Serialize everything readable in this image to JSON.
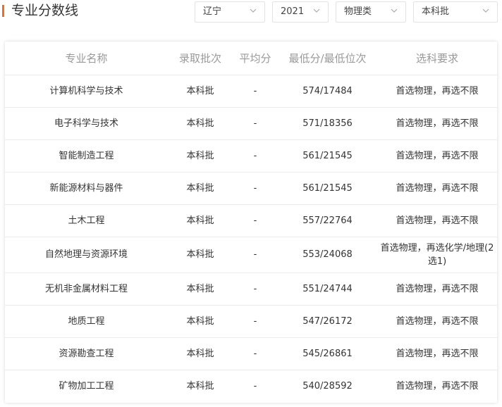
{
  "header": {
    "title": "专业分数线",
    "filters": [
      {
        "value": "辽宁"
      },
      {
        "value": "2021"
      },
      {
        "value": "物理类"
      },
      {
        "value": "本科批"
      }
    ]
  },
  "table": {
    "columns": [
      "专业名称",
      "录取批次",
      "平均分",
      "最低分/最低位次",
      "选科要求"
    ],
    "rows": [
      [
        "计算机科学与技术",
        "本科批",
        "-",
        "574/17484",
        "首选物理，再选不限"
      ],
      [
        "电子科学与技术",
        "本科批",
        "-",
        "571/18356",
        "首选物理，再选不限"
      ],
      [
        "智能制造工程",
        "本科批",
        "-",
        "561/21545",
        "首选物理，再选不限"
      ],
      [
        "新能源材料与器件",
        "本科批",
        "-",
        "561/21545",
        "首选物理，再选不限"
      ],
      [
        "土木工程",
        "本科批",
        "-",
        "557/22764",
        "首选物理，再选不限"
      ],
      [
        "自然地理与资源环境",
        "本科批",
        "-",
        "553/24068",
        "首选物理，再选化学/地理(2选1)"
      ],
      [
        "无机非金属材料工程",
        "本科批",
        "-",
        "551/24744",
        "首选物理，再选不限"
      ],
      [
        "地质工程",
        "本科批",
        "-",
        "547/26172",
        "首选物理，再选不限"
      ],
      [
        "资源勘查工程",
        "本科批",
        "-",
        "545/26861",
        "首选物理，再选不限"
      ],
      [
        "矿物加工工程",
        "本科批",
        "-",
        "540/28592",
        "首选物理，再选不限"
      ]
    ]
  },
  "colors": {
    "accent": "#f26b21",
    "header_text": "#999999",
    "border": "#ececec"
  },
  "icons": {
    "filter_dropdown": "chevron-down-icon"
  }
}
